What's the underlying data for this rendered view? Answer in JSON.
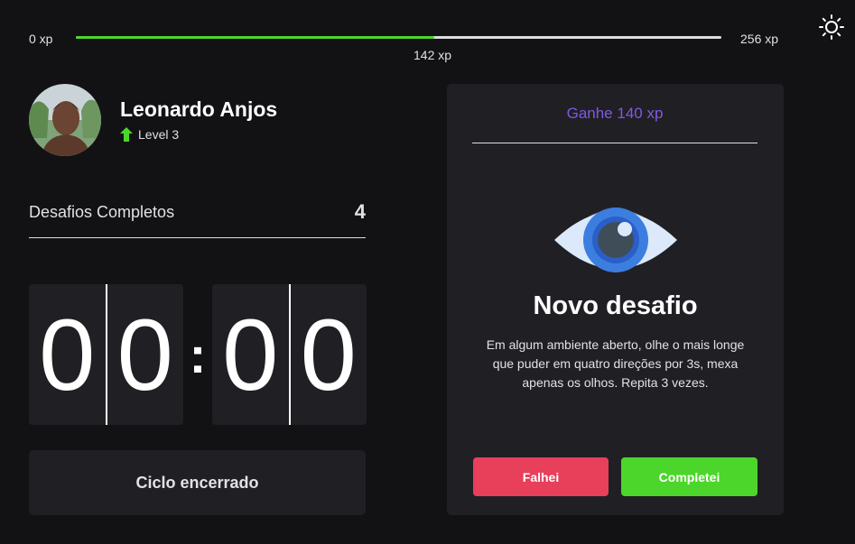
{
  "xp": {
    "min_label": "0 xp",
    "max_label": "256 xp",
    "current_label": "142 xp",
    "progress": 0.555
  },
  "user": {
    "name": "Leonardo Anjos",
    "level_label": "Level 3"
  },
  "challenges": {
    "completed_label": "Desafios Completos",
    "completed_count": "4"
  },
  "countdown": {
    "minute_tens": "0",
    "minute_ones": "0",
    "colon": ":",
    "second_tens": "0",
    "second_ones": "0",
    "cycle_label": "Ciclo encerrado"
  },
  "challenge_card": {
    "reward": "Ganhe 140 xp",
    "icon": "eye-icon",
    "title": "Novo desafio",
    "description": "Em algum ambiente aberto, olhe o mais longe que puder em quatro direções por 3s, mexa apenas os olhos. Repita 3 vezes.",
    "fail_label": "Falhei",
    "success_label": "Completei"
  },
  "colors": {
    "background": "#121214",
    "card": "#202024",
    "accent_purple": "#8257e5",
    "success_green": "#4cd62b",
    "fail_red": "#e83f5b"
  }
}
